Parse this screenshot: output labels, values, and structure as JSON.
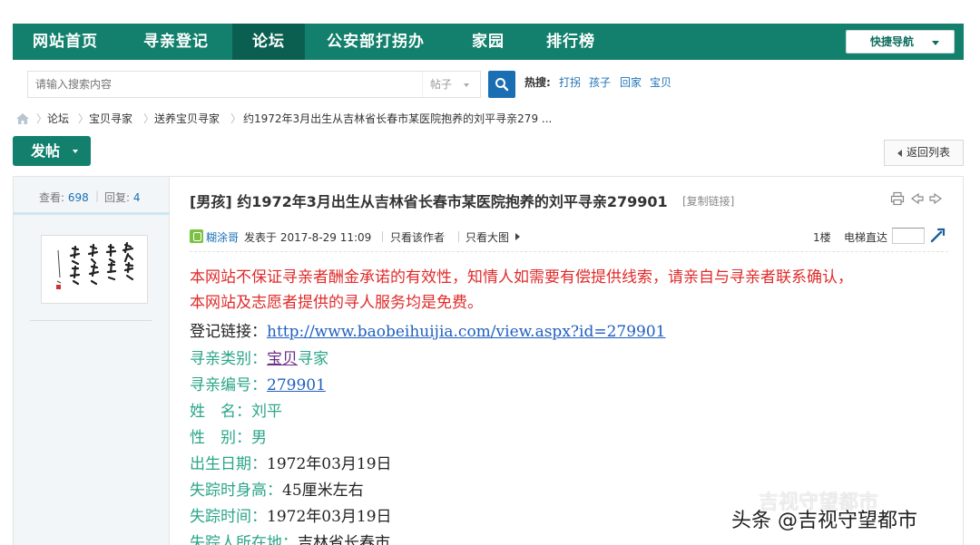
{
  "nav": {
    "items": [
      "网站首页",
      "寻亲登记",
      "论坛",
      "公安部打拐办",
      "家园",
      "排行榜"
    ],
    "active_index": 2,
    "quick_nav": "快捷导航"
  },
  "search": {
    "placeholder": "请输入搜索内容",
    "type": "帖子",
    "hot_label": "热搜:",
    "hot_links": [
      "打拐",
      "孩子",
      "回家",
      "宝贝"
    ]
  },
  "breadcrumb": [
    "论坛",
    "宝贝寻家",
    "送养宝贝寻家",
    "约1972年3月出生从吉林省长春市某医院抱养的刘平寻亲279 ..."
  ],
  "toolbar": {
    "post_label": "发帖",
    "back_label": "返回列表"
  },
  "stats": {
    "views_label": "查看:",
    "views": "698",
    "replies_label": "回复:",
    "replies": "4"
  },
  "post": {
    "title": "[男孩] 约1972年3月出生从吉林省长春市某医院抱养的刘平寻亲279901",
    "copy_link": "[复制链接]",
    "author": "糊涂哥",
    "posted": "发表于 2017-8-29 11:09",
    "only_author": "只看该作者",
    "big_image": "只看大图",
    "floor": "1楼",
    "floor_jump": "电梯直达",
    "notice_line1": "本网站不保证寻亲者酬金承诺的有效性，知情人如需要有偿提供线索，请亲自与寻亲者联系确认，",
    "notice_line2": "本网站及志愿者提供的寻人服务均是免费。",
    "fields": {
      "link_label": "登记链接：",
      "link_value": "http://www.baobeihuijia.com/view.aspx?id=279901",
      "category_label": "寻亲类别：",
      "category_value": "宝贝",
      "category_suffix": "寻家",
      "number_label": "寻亲编号：",
      "number_value": "279901",
      "name_label": "姓　名：",
      "name_value": "刘平",
      "gender_label": "性　别：",
      "gender_value": "男",
      "birth_label": "出生日期：",
      "birth_value": "1972年03月19日",
      "height_label": "失踪时身高：",
      "height_value": "45厘米左右",
      "missing_label": "失踪时间：",
      "missing_value": "1972年03月19日",
      "location_label": "失踪人所在地：",
      "location_value": "吉林省长春市"
    }
  },
  "watermark": {
    "main": "头条 @吉视守望都市",
    "ghost": "吉视守望都市"
  },
  "colors": {
    "nav_bg": "#12806c",
    "nav_active": "#0a5f50",
    "warn": "#e02b2b",
    "label": "#2aa589",
    "link": "#1f5fbf"
  }
}
